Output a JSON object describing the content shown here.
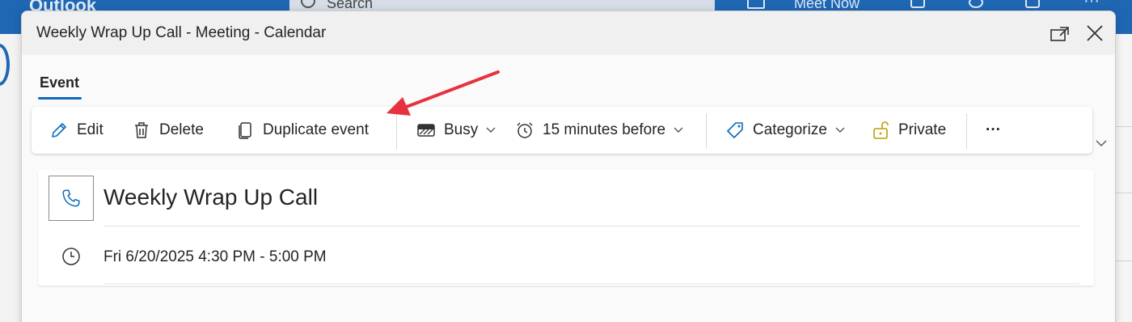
{
  "background": {
    "brand": "Outlook",
    "search_label": "Search",
    "meet_now_label": "Meet Now"
  },
  "dialog": {
    "title": "Weekly Wrap Up Call - Meeting - Calendar",
    "popout_icon": "popout-icon",
    "close_icon": "close-icon"
  },
  "tabs": [
    {
      "label": "Event",
      "selected": true
    }
  ],
  "ribbon": {
    "edit": "Edit",
    "delete": "Delete",
    "duplicate": "Duplicate event",
    "busy": "Busy",
    "reminder": "15 minutes before",
    "categorize": "Categorize",
    "private": "Private",
    "more": "···"
  },
  "event": {
    "title": "Weekly Wrap Up Call",
    "time": "Fri 6/20/2025 4:30 PM - 5:00 PM"
  },
  "colors": {
    "accent": "#0f6cbd",
    "outlook_blue": "#1f66b3",
    "private_lock": "#c19c00",
    "annotation_arrow": "#e8313f"
  }
}
